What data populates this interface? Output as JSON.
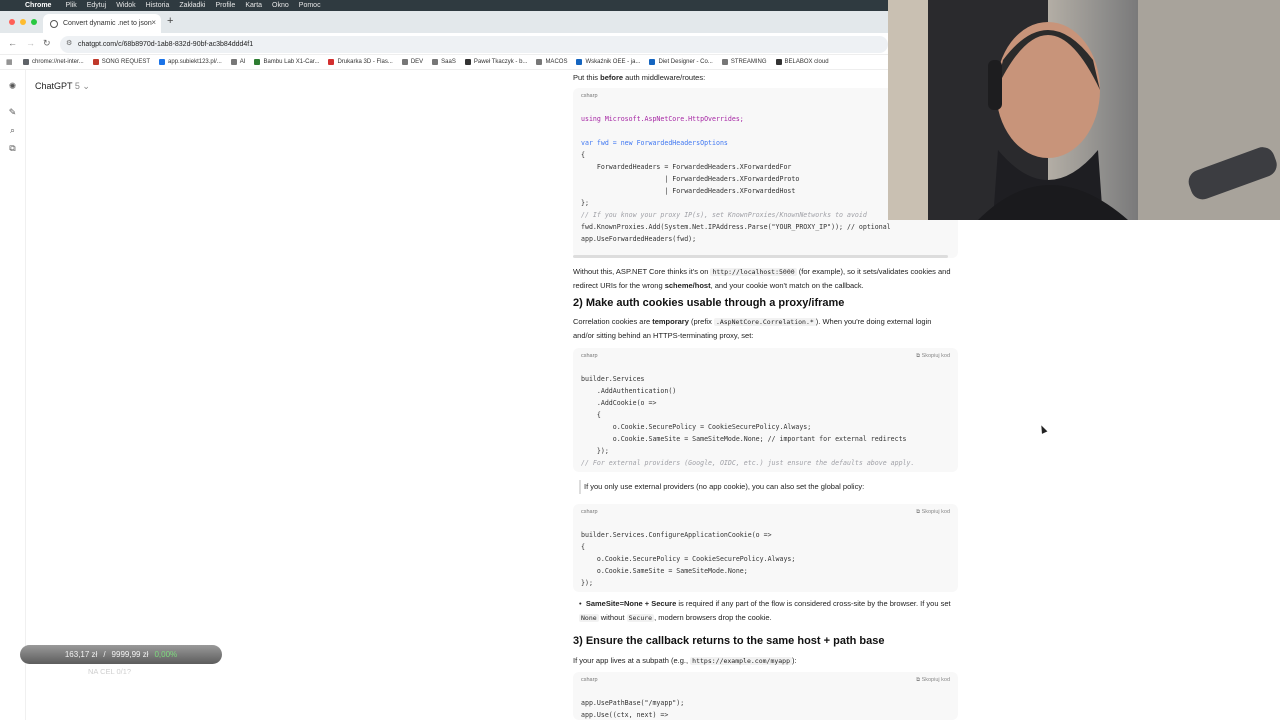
{
  "menubar": {
    "app": "Chrome",
    "items": [
      "Plik",
      "Edytuj",
      "Widok",
      "Historia",
      "Zakładki",
      "Profile",
      "Karta",
      "Okno",
      "Pomoc"
    ]
  },
  "browser": {
    "tab_title": "Convert dynamic .net to json",
    "url": "chatgpt.com/c/68b8970d-1ab8-832d-90bf-ac3b84ddd4f1",
    "bookmarks": [
      {
        "label": "chrome://net-inter...",
        "color": "#5f6368"
      },
      {
        "label": "SONG REQUEST",
        "color": "#c0392b"
      },
      {
        "label": "app.subiekt123.pl/...",
        "color": "#1a73e8"
      },
      {
        "label": "AI",
        "color": "#777777"
      },
      {
        "label": "Bambu Lab X1-Car...",
        "color": "#2e7d32"
      },
      {
        "label": "Drukarka 3D - Flas...",
        "color": "#d32f2f"
      },
      {
        "label": "DEV",
        "color": "#777777"
      },
      {
        "label": "SaaS",
        "color": "#777777"
      },
      {
        "label": "Paweł Tkaczyk - b...",
        "color": "#333333"
      },
      {
        "label": "MACOS",
        "color": "#777777"
      },
      {
        "label": "Wskaźnik OEE - ja...",
        "color": "#1565c0"
      },
      {
        "label": "Diet Designer - Co...",
        "color": "#1565c0"
      },
      {
        "label": "STREAMING",
        "color": "#777777"
      },
      {
        "label": "BELABOX cloud",
        "color": "#333333"
      }
    ]
  },
  "sidebar": {
    "model_name": "ChatGPT",
    "model_version": "5"
  },
  "content": {
    "intro": "Put this",
    "intro_bold": "before",
    "intro_rest": "auth middleware/routes:",
    "code1": {
      "lang": "csharp",
      "lines": [
        "using Microsoft.AspNetCore.HttpOverrides;",
        "",
        "var fwd = new ForwardedHeadersOptions",
        "{",
        "    ForwardedHeaders = ForwardedHeaders.XForwardedFor",
        "                     | ForwardedHeaders.XForwardedProto",
        "                     | ForwardedHeaders.XForwardedHost",
        "};",
        "// If you know your proxy IP(s), set KnownProxies/KnownNetworks to avoid",
        "fwd.KnownProxies.Add(System.Net.IPAddress.Parse(\"YOUR_PROXY_IP\")); // optional",
        "app.UseForwardedHeaders(fwd);"
      ]
    },
    "para1_a": "Without this, ASP.NET Core thinks it's on",
    "para1_code": "http://localhost:5000",
    "para1_b": "(for example), so it sets/validates cookies and redirect URIs for the wrong",
    "para1_bold": "scheme/host",
    "para1_c": ", and your cookie won't match on the callback.",
    "h2": "2) Make auth cookies usable through a proxy/iframe",
    "para2_a": "Correlation cookies are",
    "para2_bold": "temporary",
    "para2_b": "(prefix",
    "para2_code": ".AspNetCore.Correlation.*",
    "para2_c": "). When you're doing external login and/or sitting behind an HTTPS-terminating proxy, set:",
    "code2": {
      "lang": "csharp",
      "copy": "Skopiuj kod",
      "lines": [
        "builder.Services",
        "    .AddAuthentication()",
        "    .AddCookie(o =>",
        "    {",
        "        o.Cookie.SecurePolicy = CookieSecurePolicy.Always;",
        "        o.Cookie.SameSite = SameSiteMode.None; // important for external redirects",
        "    });",
        "// For external providers (Google, OIDC, etc.) just ensure the defaults above apply."
      ]
    },
    "quote": "If you only use external providers (no app cookie), you can also set the global policy:",
    "code3": {
      "lang": "csharp",
      "copy": "Skopiuj kod",
      "lines": [
        "builder.Services.ConfigureApplicationCookie(o =>",
        "{",
        "    o.Cookie.SecurePolicy = CookieSecurePolicy.Always;",
        "    o.Cookie.SameSite = SameSiteMode.None;",
        "});"
      ]
    },
    "bullet_bold": "SameSite=None + Secure",
    "bullet_a": "is required if any part of the flow is considered cross-site by the browser. If you set",
    "bullet_code1": "None",
    "bullet_b": "without",
    "bullet_code2": "Secure",
    "bullet_c": ", modern browsers drop the cookie.",
    "h3": "3) Ensure the callback returns to the same host + path base",
    "para3_a": "If your app lives at a subpath (e.g.,",
    "para3_code": "https://example.com/myapp",
    "para3_b": "):",
    "code4": {
      "lang": "csharp",
      "copy": "Skopiuj kod",
      "lines": [
        "app.UsePathBase(\"/myapp\");",
        "app.Use((ctx, next) =>"
      ]
    }
  },
  "overlay": {
    "amount1": "163,17 zł",
    "amount2": "9999,99 zł",
    "amount3": "0,00%",
    "sub": "NA CEL 0/1?"
  }
}
